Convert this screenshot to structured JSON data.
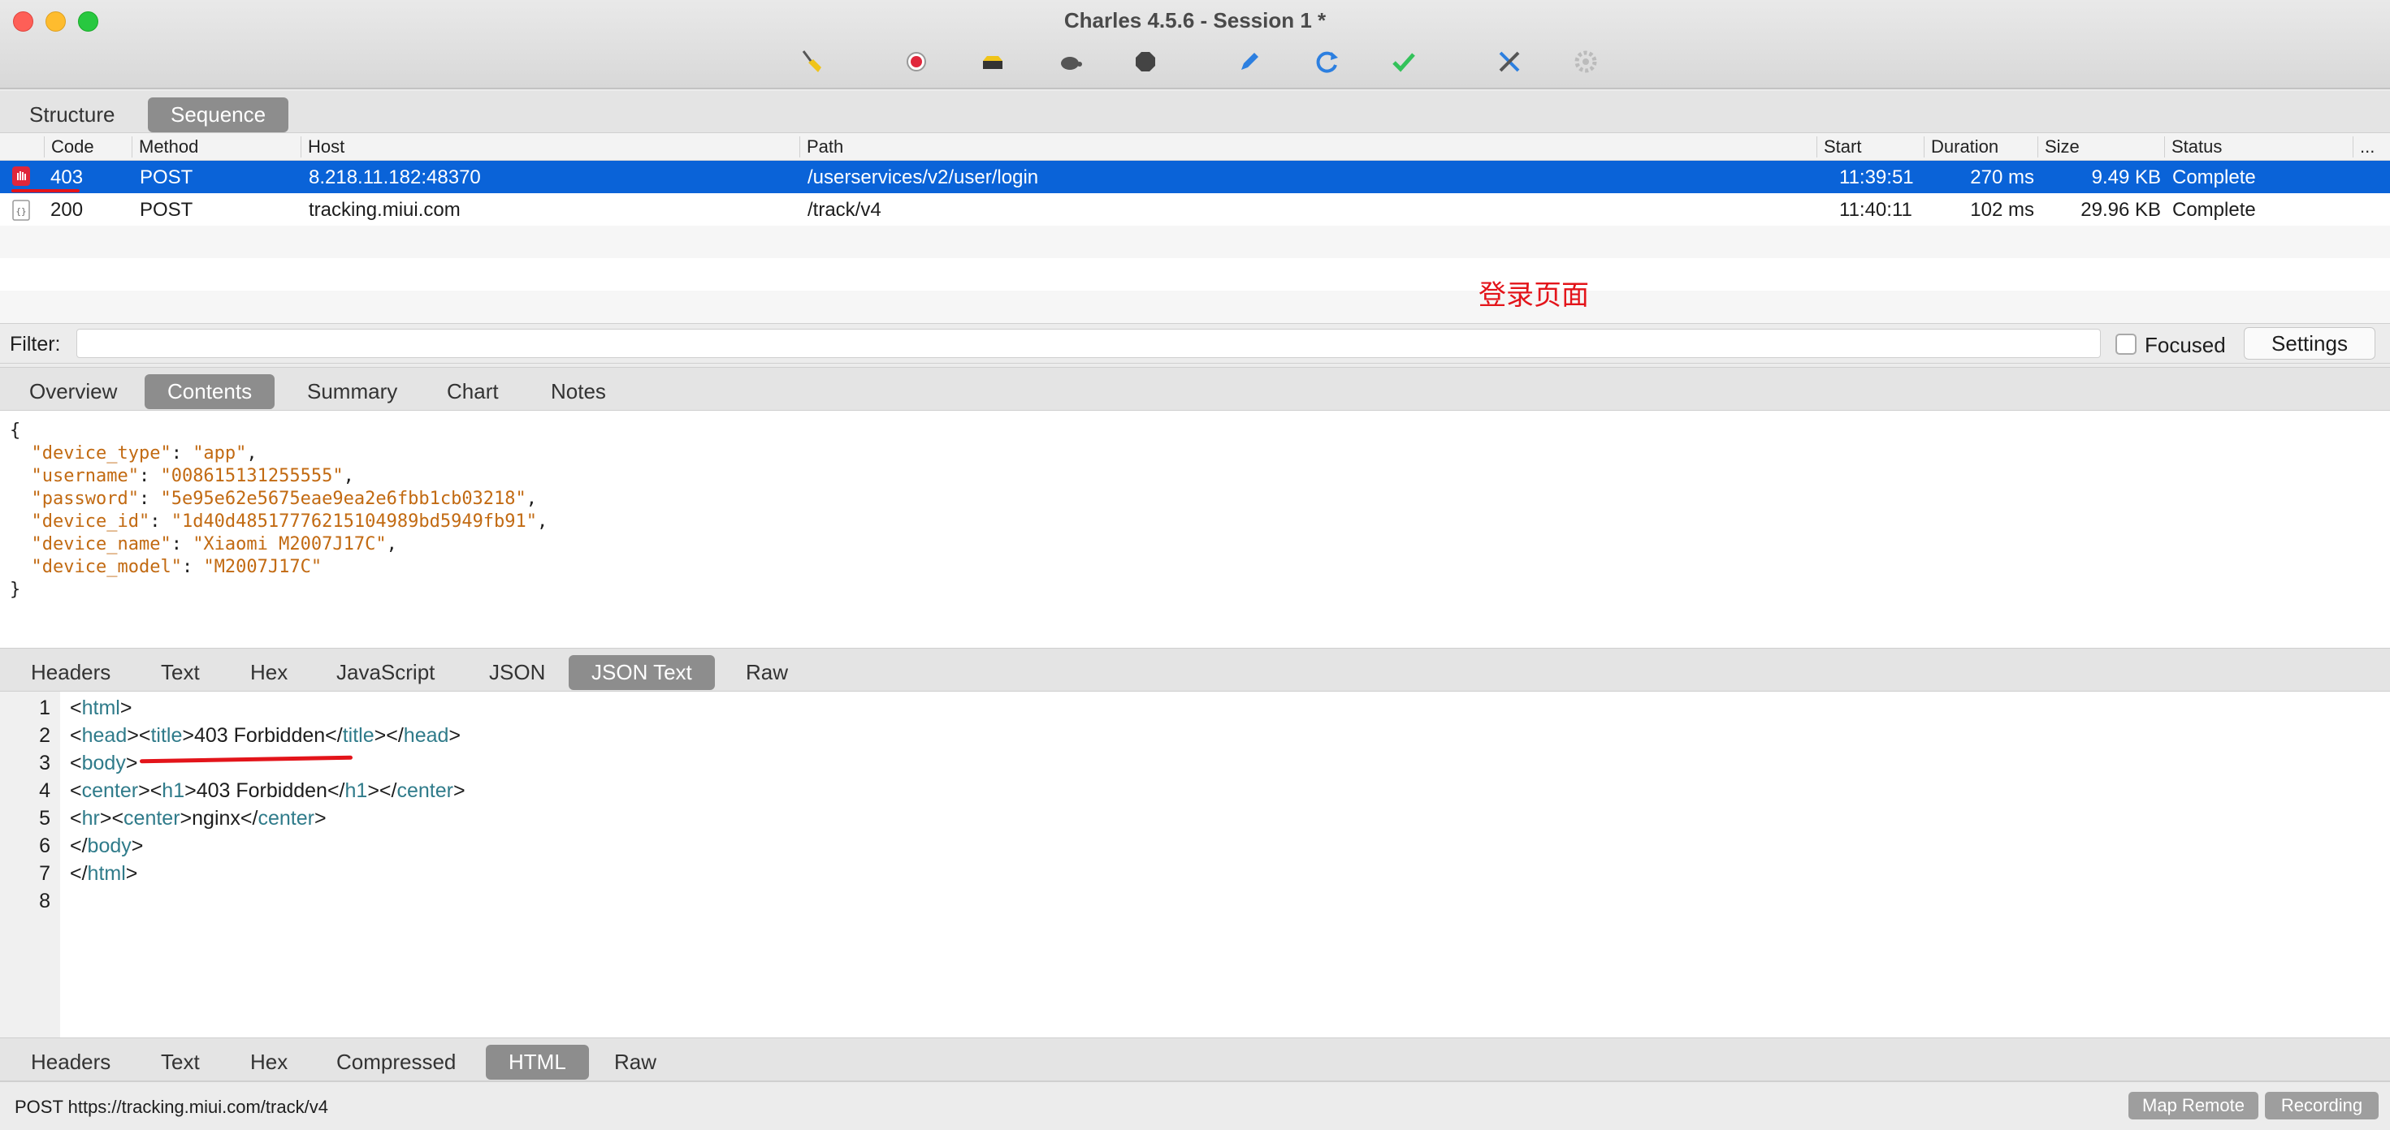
{
  "window": {
    "title": "Charles 4.5.6 - Session 1 *"
  },
  "toolbar": {
    "icons": [
      "broom-icon",
      "record-icon",
      "throttle-icon",
      "turtle-icon",
      "stop-icon",
      "pen-icon",
      "refresh-icon",
      "check-icon",
      "tools-icon",
      "settings-gear-icon"
    ]
  },
  "view_tabs": {
    "structure": "Structure",
    "sequence": "Sequence",
    "active": "Sequence"
  },
  "table": {
    "columns": {
      "code": "Code",
      "method": "Method",
      "host": "Host",
      "path": "Path",
      "start": "Start",
      "duration": "Duration",
      "size": "Size",
      "status": "Status",
      "more": "..."
    },
    "rows": [
      {
        "code": "403",
        "method": "POST",
        "host": "8.218.11.182:48370",
        "path": "/userservices/v2/user/login",
        "start": "11:39:51",
        "duration": "270 ms",
        "size": "9.49 KB",
        "status": "Complete",
        "selected": true
      },
      {
        "code": "200",
        "method": "POST",
        "host": "tracking.miui.com",
        "path": "/track/v4",
        "start": "11:40:11",
        "duration": "102 ms",
        "size": "29.96 KB",
        "status": "Complete",
        "selected": false
      }
    ]
  },
  "annotation": {
    "text": "登录页面",
    "color": "#e3141a"
  },
  "filter": {
    "label": "Filter:",
    "value": "",
    "focused_label": "Focused",
    "focused_checked": false,
    "settings_label": "Settings"
  },
  "request_tabs": {
    "items": [
      "Overview",
      "Contents",
      "Summary",
      "Chart",
      "Notes"
    ],
    "active": "Contents"
  },
  "request_body": {
    "open": "{",
    "fields": [
      {
        "key": "\"device_type\"",
        "value": "\"app\"",
        "comma": ","
      },
      {
        "key": "\"username\"",
        "value": "\"008615131255555\"",
        "comma": ","
      },
      {
        "key": "\"password\"",
        "value": "\"5e95e62e5675eae9ea2e6fbb1cb03218\"",
        "comma": ","
      },
      {
        "key": "\"device_id\"",
        "value": "\"1d40d48517776215104989bd5949fb91\"",
        "comma": ","
      },
      {
        "key": "\"device_name\"",
        "value": "\"Xiaomi M2007J17C\"",
        "comma": ","
      },
      {
        "key": "\"device_model\"",
        "value": "\"M2007J17C\"",
        "comma": ""
      }
    ],
    "close": "}"
  },
  "format_tabs_request": {
    "items": [
      "Headers",
      "Text",
      "Hex",
      "JavaScript",
      "JSON",
      "JSON Text",
      "Raw"
    ],
    "active": "JSON Text"
  },
  "response_body": {
    "line_numbers": [
      "1",
      "2",
      "3",
      "4",
      "5",
      "6",
      "7",
      "8"
    ],
    "lines": [
      [
        {
          "t": "<",
          "c": ""
        },
        {
          "t": "html",
          "c": "tg"
        },
        {
          "t": ">",
          "c": ""
        }
      ],
      [
        {
          "t": "<",
          "c": ""
        },
        {
          "t": "head",
          "c": "tg"
        },
        {
          "t": "><",
          "c": ""
        },
        {
          "t": "title",
          "c": "tg"
        },
        {
          "t": ">403 Forbidden</",
          "c": ""
        },
        {
          "t": "title",
          "c": "tg"
        },
        {
          "t": "></",
          "c": ""
        },
        {
          "t": "head",
          "c": "tg"
        },
        {
          "t": ">",
          "c": ""
        }
      ],
      [
        {
          "t": "<",
          "c": ""
        },
        {
          "t": "body",
          "c": "tg"
        },
        {
          "t": ">",
          "c": ""
        }
      ],
      [
        {
          "t": "<",
          "c": ""
        },
        {
          "t": "center",
          "c": "tg"
        },
        {
          "t": "><",
          "c": ""
        },
        {
          "t": "h1",
          "c": "tg"
        },
        {
          "t": ">403 Forbidden</",
          "c": ""
        },
        {
          "t": "h1",
          "c": "tg"
        },
        {
          "t": "></",
          "c": ""
        },
        {
          "t": "center",
          "c": "tg"
        },
        {
          "t": ">",
          "c": ""
        }
      ],
      [
        {
          "t": "<",
          "c": ""
        },
        {
          "t": "hr",
          "c": "tg"
        },
        {
          "t": "><",
          "c": ""
        },
        {
          "t": "center",
          "c": "tg"
        },
        {
          "t": ">nginx</",
          "c": ""
        },
        {
          "t": "center",
          "c": "tg"
        },
        {
          "t": ">",
          "c": ""
        }
      ],
      [
        {
          "t": "</",
          "c": ""
        },
        {
          "t": "body",
          "c": "tg"
        },
        {
          "t": ">",
          "c": ""
        }
      ],
      [
        {
          "t": "</",
          "c": ""
        },
        {
          "t": "html",
          "c": "tg"
        },
        {
          "t": ">",
          "c": ""
        }
      ],
      []
    ]
  },
  "format_tabs_response": {
    "items": [
      "Headers",
      "Text",
      "Hex",
      "Compressed",
      "HTML",
      "Raw"
    ],
    "active": "HTML"
  },
  "statusbar": {
    "text": "POST https://tracking.miui.com/track/v4",
    "map_remote": "Map Remote",
    "recording": "Recording"
  }
}
